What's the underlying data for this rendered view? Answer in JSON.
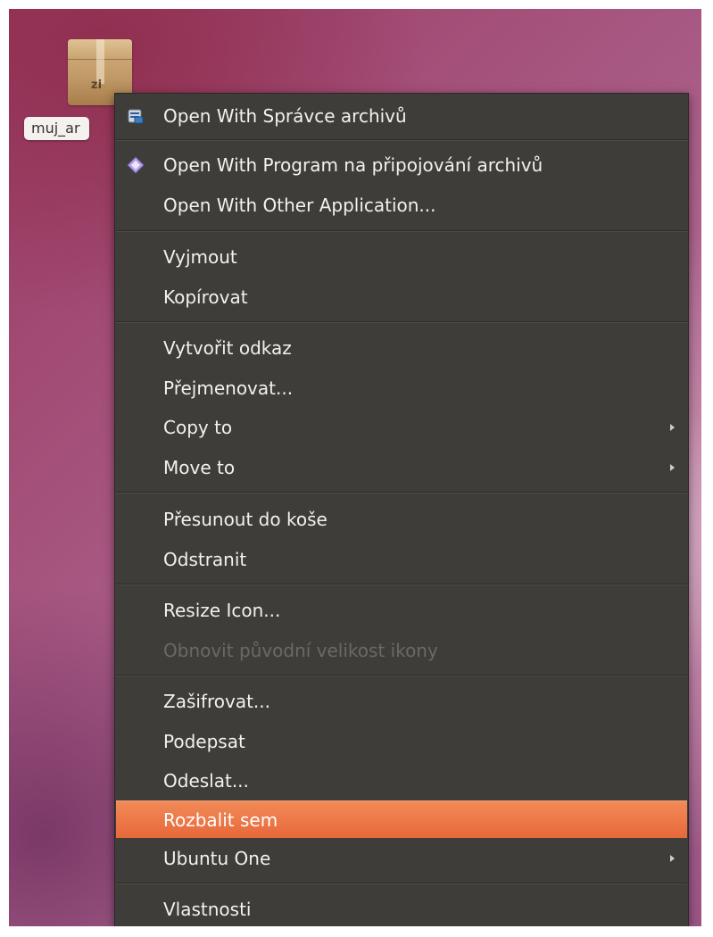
{
  "desktop": {
    "file": {
      "icon": "zip-archive-icon",
      "ext_label": "zi",
      "name_label": "muj_ar"
    }
  },
  "context_menu": {
    "items": [
      {
        "label": "Open With Správce archivů",
        "icon": "archive-manager-icon"
      },
      {
        "label": "Open With Program na připojování archivů",
        "icon": "archive-mounter-icon"
      },
      {
        "label": "Open With Other Application..."
      },
      {
        "label": "Vyjmout"
      },
      {
        "label": "Kopírovat"
      },
      {
        "label": "Vytvořit odkaz"
      },
      {
        "label": "Přejmenovat..."
      },
      {
        "label": "Copy to",
        "submenu": true
      },
      {
        "label": "Move to",
        "submenu": true
      },
      {
        "label": "Přesunout do koše"
      },
      {
        "label": "Odstranit"
      },
      {
        "label": "Resize Icon..."
      },
      {
        "label": "Obnovit původní velikost ikony",
        "disabled": true
      },
      {
        "label": "Zašifrovat..."
      },
      {
        "label": "Podepsat"
      },
      {
        "label": "Odeslat..."
      },
      {
        "label": "Rozbalit sem",
        "selected": true
      },
      {
        "label": "Ubuntu One",
        "submenu": true
      },
      {
        "label": "Vlastnosti"
      }
    ]
  },
  "colors": {
    "menu_background": "#3e3d39",
    "menu_text": "#f2f1ef",
    "disabled_text": "#6b6964",
    "highlight": "#e9703f"
  }
}
